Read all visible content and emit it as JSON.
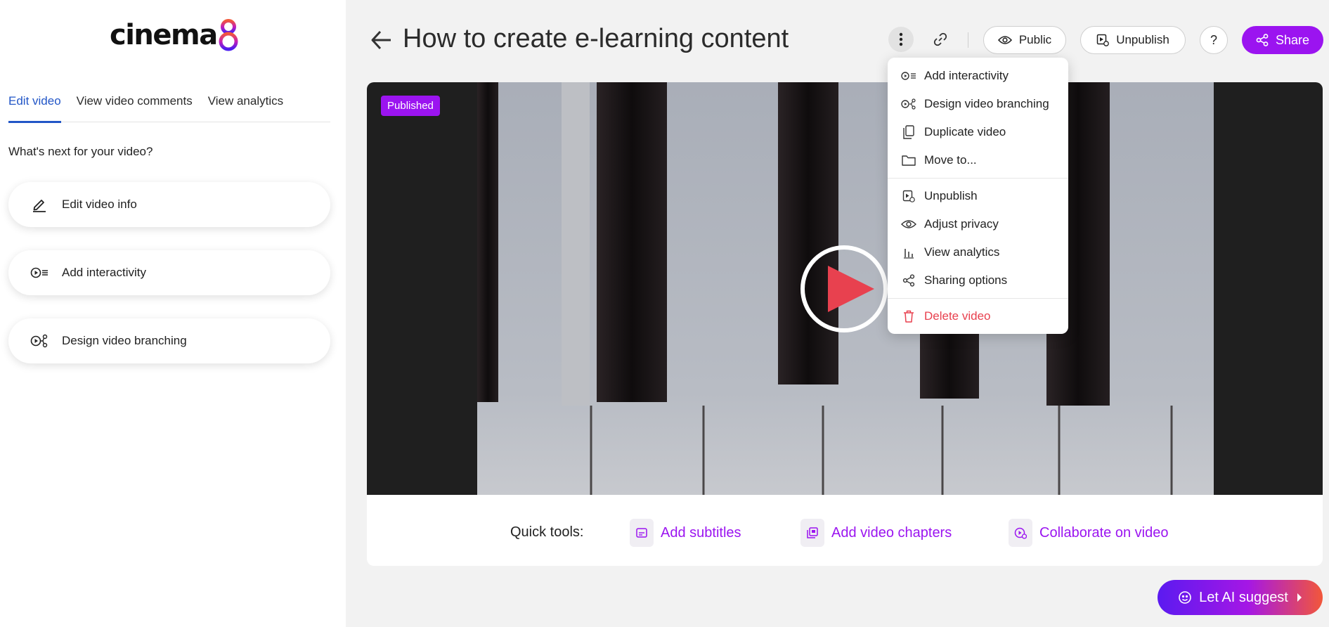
{
  "app": {
    "logo_text": "cinema",
    "brand_color": "#9b14f0"
  },
  "sidebar": {
    "tabs": [
      {
        "label": "Edit video",
        "active": true
      },
      {
        "label": "View video comments",
        "active": false
      },
      {
        "label": "View analytics",
        "active": false
      }
    ],
    "heading": "What's next for your video?",
    "actions": [
      {
        "label": "Edit video info",
        "icon": "pencil-icon"
      },
      {
        "label": "Add interactivity",
        "icon": "interactivity-icon"
      },
      {
        "label": "Design video branching",
        "icon": "branching-icon"
      }
    ]
  },
  "header": {
    "title": "How to create e-learning content",
    "public_label": "Public",
    "unpublish_label": "Unpublish",
    "help_label": "?",
    "share_label": "Share"
  },
  "video": {
    "status_badge": "Published"
  },
  "quick_tools": {
    "label": "Quick tools:",
    "items": [
      {
        "label": "Add subtitles",
        "icon": "subtitles-icon"
      },
      {
        "label": "Add video chapters",
        "icon": "chapters-icon"
      },
      {
        "label": "Collaborate on video",
        "icon": "collaborate-icon"
      }
    ]
  },
  "menu": {
    "items": [
      {
        "label": "Add interactivity",
        "icon": "interactivity-icon"
      },
      {
        "label": "Design video branching",
        "icon": "branching-icon"
      },
      {
        "label": "Duplicate video",
        "icon": "duplicate-icon"
      },
      {
        "label": "Move to...",
        "icon": "folder-icon"
      },
      {
        "label": "Unpublish",
        "icon": "unpublish-icon"
      },
      {
        "label": "Adjust privacy",
        "icon": "eye-icon"
      },
      {
        "label": "View analytics",
        "icon": "analytics-icon"
      },
      {
        "label": "Sharing options",
        "icon": "share-icon"
      },
      {
        "label": "Delete video",
        "icon": "trash-icon"
      }
    ]
  },
  "ai_button": {
    "label": "Let AI suggest"
  }
}
